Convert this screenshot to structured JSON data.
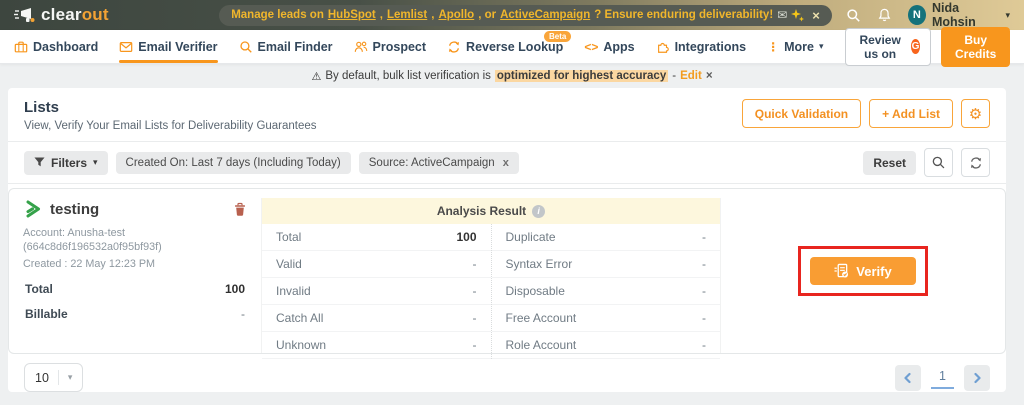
{
  "topbar": {
    "logo_clear": "clear",
    "logo_out": "out",
    "banner": {
      "t1": "Manage leads on ",
      "l1": "HubSpot",
      "s1": ", ",
      "l2": "Lemlist",
      "s2": ", ",
      "l3": "Apollo",
      "s3": ", or ",
      "l4": "ActiveCampaign",
      "t2": "? Ensure enduring deliverability!",
      "close": "×"
    },
    "user": {
      "initial": "N",
      "name": "Nida Mohsin"
    }
  },
  "nav": {
    "items": [
      {
        "label": "Dashboard"
      },
      {
        "label": "Email Verifier"
      },
      {
        "label": "Email Finder"
      },
      {
        "label": "Prospect"
      },
      {
        "label": "Reverse Lookup",
        "badge": "Beta"
      },
      {
        "label": "Apps"
      },
      {
        "label": "Integrations"
      },
      {
        "label": "More"
      }
    ],
    "review_label": "Review us on",
    "review_logo": "G",
    "buy_credits": "Buy Credits"
  },
  "notice": {
    "t1": "By default, bulk list verification is",
    "highlight": "optimized for highest accuracy",
    "dash": "-",
    "edit": "Edit",
    "close": "×"
  },
  "page": {
    "title": "Lists",
    "subtitle": "View, Verify Your Email Lists for Deliverability Guarantees",
    "quick_validation": "Quick Validation",
    "add_list": "+ Add List"
  },
  "filters": {
    "label": "Filters",
    "chip1": "Created On: Last 7 days (Including Today)",
    "chip2": "Source: ActiveCampaign",
    "chip2_close": "x",
    "reset": "Reset"
  },
  "list": {
    "name": "testing",
    "account": "Account: Anusha-test (664c8d6f196532a0f95bf93f)",
    "created": "Created : 22 May 12:23 PM",
    "total_label": "Total",
    "total_value": "100",
    "billable_label": "Billable",
    "billable_value": "-",
    "analysis_title": "Analysis Result",
    "analysis_left": [
      {
        "label": "Total",
        "value": "100"
      },
      {
        "label": "Valid",
        "value": "-"
      },
      {
        "label": "Invalid",
        "value": "-"
      },
      {
        "label": "Catch All",
        "value": "-"
      },
      {
        "label": "Unknown",
        "value": "-"
      }
    ],
    "analysis_right": [
      {
        "label": "Duplicate",
        "value": "-"
      },
      {
        "label": "Syntax Error",
        "value": "-"
      },
      {
        "label": "Disposable",
        "value": "-"
      },
      {
        "label": "Free Account",
        "value": "-"
      },
      {
        "label": "Role Account",
        "value": "-"
      }
    ],
    "verify": "Verify"
  },
  "pagination": {
    "page_size": "10",
    "page": "1"
  },
  "glyphs": {
    "caret_down": "▾",
    "dots_vertical": "⋮",
    "code_glyph": "<>",
    "gear": "⚙",
    "warning": "⚠",
    "envelope": "✉",
    "info": "i"
  },
  "colors": {
    "accent_orange": "#f8961d",
    "highlight_red": "#e8251f",
    "list_source_green": "#35a24a",
    "pagination_blue": "#6f9fd2",
    "avatar_teal": "#15727b",
    "analysis_header_yellow": "#fdf7dd"
  }
}
